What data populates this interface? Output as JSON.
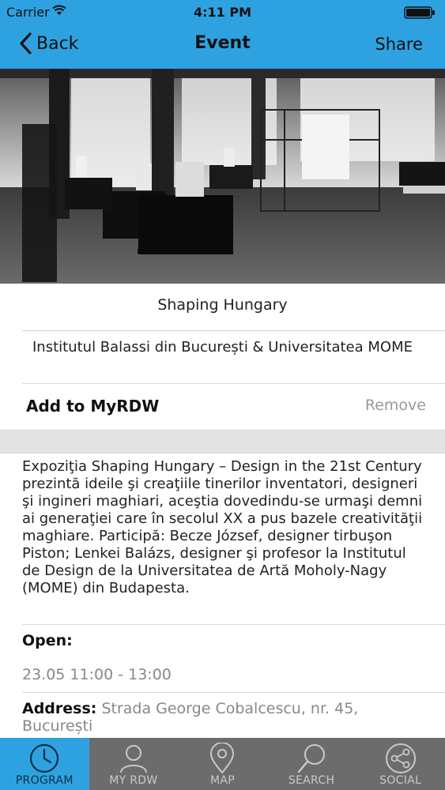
{
  "status_bar": {
    "carrier": "Carrier",
    "time": "4:11 PM"
  },
  "nav": {
    "back_label": "Back",
    "title": "Event",
    "share_label": "Share"
  },
  "event": {
    "title": "Shaping Hungary",
    "organizer": "Institutul Balassi din București & Universitatea MOME",
    "add_label": "Add to MyRDW",
    "remove_label": "Remove",
    "description": "Expoziţia Shaping Hungary – Design in the 21st Century prezintă ideile şi creaţiile tinerilor inventatori, designeri şi ingineri maghiari, aceştia dovedindu-se urmaşi demni ai generaţiei care în secolul XX a pus bazele creativităţii maghiare. Participă: Becze József, designer tirbuşon Piston; Lenkei Balázs, designer şi profesor la Institutul de Design de la Universitatea de Artă Moholy-Nagy (MOME) din Budapesta.",
    "open_label": "Open:",
    "open_time": "23.05 11:00 - 13:00",
    "address_label": "Address:",
    "address_value": "Strada George Cobalcescu, nr. 45, București"
  },
  "tabs": [
    {
      "label": "PROGRAM",
      "icon": "clock-icon",
      "active": true
    },
    {
      "label": "MY RDW",
      "icon": "person-icon",
      "active": false
    },
    {
      "label": "MAP",
      "icon": "map-pin-icon",
      "active": false
    },
    {
      "label": "SEARCH",
      "icon": "magnifier-icon",
      "active": false
    },
    {
      "label": "SOCIAL",
      "icon": "share-network-icon",
      "active": false
    }
  ],
  "colors": {
    "accent": "#2ea2e0",
    "tabbar": "#6c6c6c",
    "muted_text": "#888888"
  }
}
